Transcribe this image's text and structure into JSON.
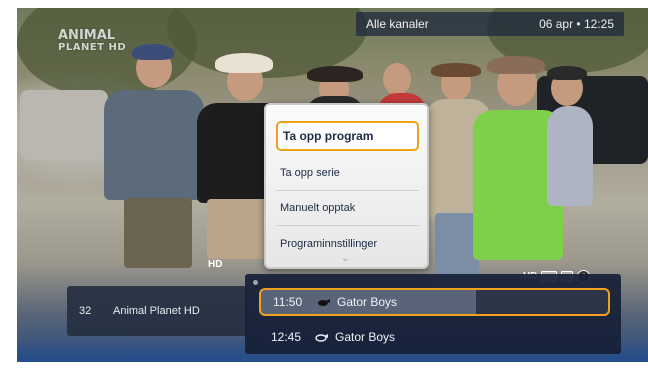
{
  "channel_logo": {
    "line1": "ANIMAL",
    "line2": "PLANET HD"
  },
  "topbar": {
    "channel_filter": "Alle kanaler",
    "datetime": "06 apr • 12:25"
  },
  "context_menu": {
    "items": [
      {
        "label": "Ta opp program",
        "selected": true
      },
      {
        "label": "Ta opp serie",
        "selected": false
      },
      {
        "label": "Manuelt opptak",
        "selected": false
      },
      {
        "label": "Programinnstillinger",
        "selected": false
      }
    ],
    "more_indicator": "⌄"
  },
  "badges": {
    "hd_small": "HD",
    "hd": "HD",
    "info": "i"
  },
  "channel": {
    "number": "32",
    "name": "Animal Planet HD"
  },
  "epg": {
    "programs": [
      {
        "time": "11:50",
        "title": "Gator Boys",
        "icon": "record-icon"
      },
      {
        "time": "12:45",
        "title": "Gator Boys",
        "icon": "record-series-icon"
      }
    ]
  },
  "colors": {
    "focus": "#f0a21e",
    "panel": "#16203a",
    "menu_text": "#1d2b45"
  }
}
